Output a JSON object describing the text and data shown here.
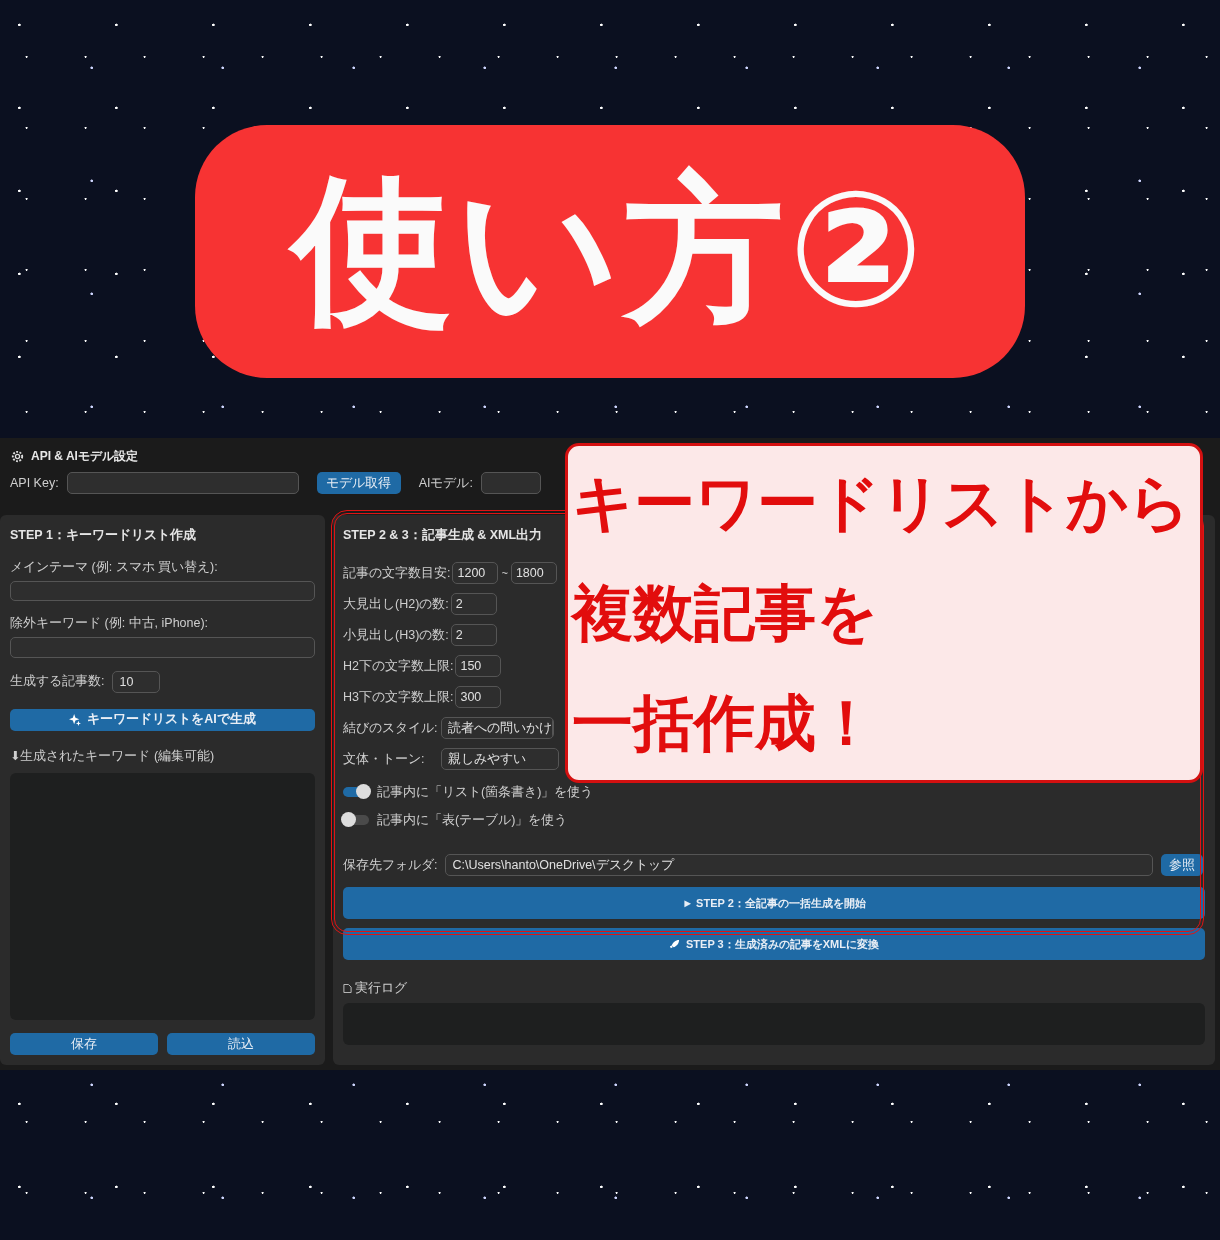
{
  "title_badge": {
    "text": "使い方②"
  },
  "settings": {
    "title": "API & AIモデル設定",
    "api_key_label": "API Key:",
    "fetch_button": "モデル取得",
    "model_label": "AIモデル:"
  },
  "step1": {
    "title": "STEP 1：キーワードリスト作成",
    "main_theme_label": "メインテーマ (例: スマホ 買い替え):",
    "exclude_label": "除外キーワード (例: 中古, iPhone):",
    "count_label": "生成する記事数:",
    "count_value": "10",
    "generate_button": "キーワードリストをAIで生成",
    "keywords_label": "⬇生成されたキーワード (編集可能)",
    "save_button": "保存",
    "load_button": "読込"
  },
  "step2": {
    "title": "STEP 2 & 3：記事生成 & XML出力",
    "fields": [
      {
        "kind": "range",
        "label": "記事の文字数目安:",
        "value": "1200",
        "separator": "~",
        "value_2": "1800"
      },
      {
        "kind": "input",
        "label": "大見出し(H2)の数:",
        "value": "2"
      },
      {
        "kind": "input",
        "label": "小見出し(H3)の数:",
        "value": "2"
      },
      {
        "kind": "input",
        "label": "H2下の文字数上限:",
        "value": "150"
      },
      {
        "kind": "input",
        "label": "H3下の文字数上限:",
        "value": "300"
      },
      {
        "kind": "select",
        "label": "結びのスタイル:",
        "value": "読者への問いかけ"
      },
      {
        "kind": "wide",
        "label": "文体・トーン:",
        "value": "親しみやすい"
      }
    ],
    "toggles": [
      {
        "label": "記事内に「リスト(箇条書き)」を使う",
        "on": true
      },
      {
        "label": "記事内に「表(テーブル)」を使う",
        "on": false
      }
    ],
    "folder": {
      "label": "保存先フォルダ:",
      "value": "C:\\Users\\hanto\\OneDrive\\デスクトップ",
      "browse_button": "参照"
    },
    "start_button": "► STEP 2：全記事の一括生成を開始",
    "convert_button": "STEP 3：生成済みの記事をXMLに変換",
    "log_label": "実行ログ"
  },
  "callout": {
    "lines": [
      "キーワードリストから",
      "複数記事を",
      "一括作成！"
    ]
  }
}
